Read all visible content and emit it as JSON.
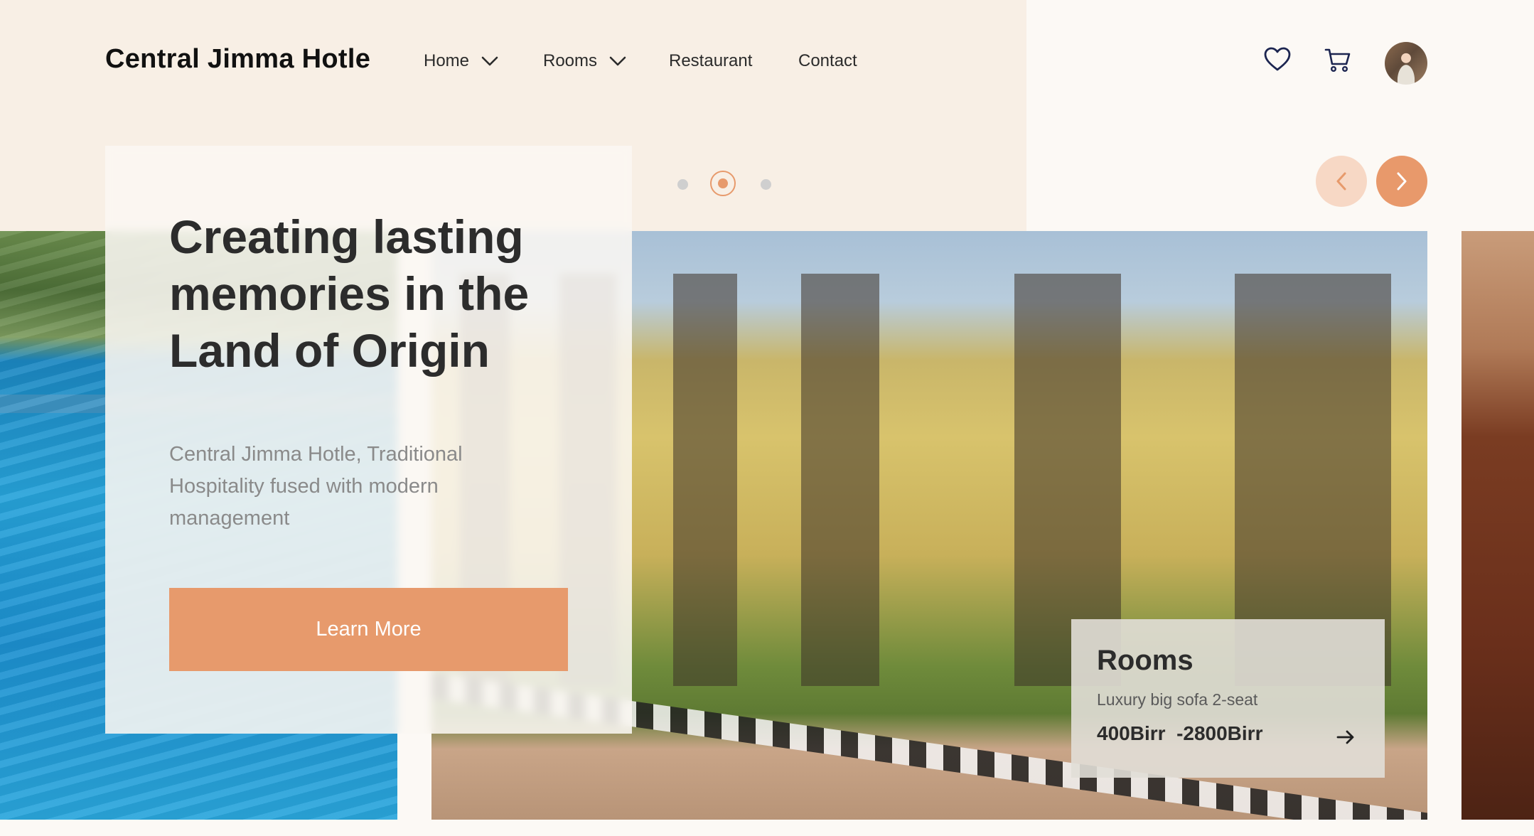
{
  "brand": {
    "name": "Central Jimma Hotle"
  },
  "nav": {
    "items": [
      {
        "label": "Home",
        "has_dropdown": true
      },
      {
        "label": "Rooms",
        "has_dropdown": true
      },
      {
        "label": "Restaurant",
        "has_dropdown": false
      },
      {
        "label": "Contact",
        "has_dropdown": false
      }
    ]
  },
  "header_icons": [
    "heart-icon",
    "cart-icon",
    "avatar"
  ],
  "carousel": {
    "slide_count": 3,
    "active_index": 1
  },
  "hero": {
    "title": "Creating lasting memories in the Land of Origin",
    "subtitle": "Central Jimma Hotle, Traditional Hospitality fused with modern management",
    "cta_label": "Learn More"
  },
  "rooms_card": {
    "title": "Rooms",
    "description": "Luxury big sofa 2-seat",
    "price": "400Birr  -2800Birr"
  },
  "colors": {
    "accent": "#e79a6c",
    "accent_light": "#f7d8c5",
    "band": "#f8efe5",
    "background": "#fcf9f5",
    "heading": "#2c2c2c"
  }
}
